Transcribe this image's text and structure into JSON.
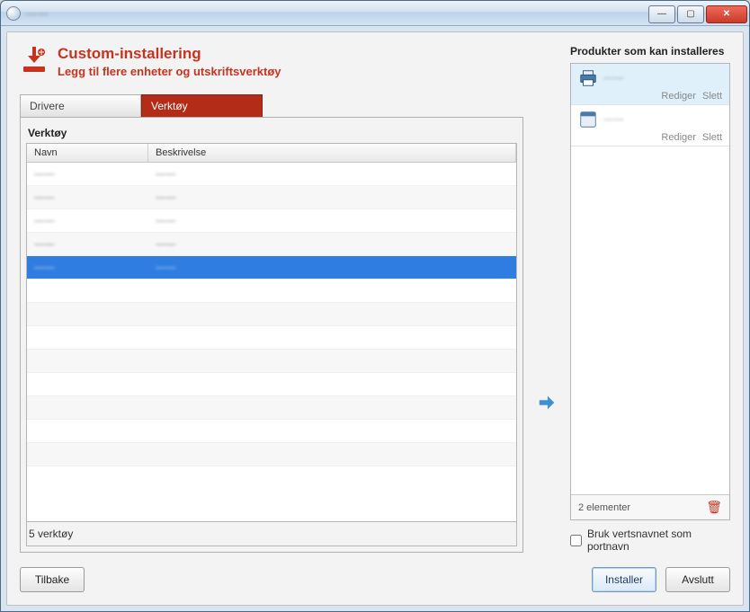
{
  "window": {
    "title": "——"
  },
  "header": {
    "title": "Custom-installering",
    "subtitle": "Legg til flere enheter og utskriftsverktøy"
  },
  "tabs": {
    "drivers": "Drivere",
    "tools": "Verktøy"
  },
  "section_label": "Verktøy",
  "columns": {
    "name": "Navn",
    "desc": "Beskrivelse"
  },
  "rows": [
    {
      "name": "——",
      "desc": "——"
    },
    {
      "name": "——",
      "desc": "——"
    },
    {
      "name": "——",
      "desc": "——"
    },
    {
      "name": "——",
      "desc": "——"
    },
    {
      "name": "——",
      "desc": "——"
    }
  ],
  "footer_count": "5 verktøy",
  "right": {
    "title": "Produkter som kan installeres",
    "edit": "Rediger",
    "delete": "Slett",
    "products": [
      {
        "name": "——"
      },
      {
        "name": "——"
      }
    ],
    "count": "2 elementer"
  },
  "checkbox_label": "Bruk vertsnavnet som portnavn",
  "buttons": {
    "back": "Tilbake",
    "install": "Installer",
    "quit": "Avslutt"
  }
}
